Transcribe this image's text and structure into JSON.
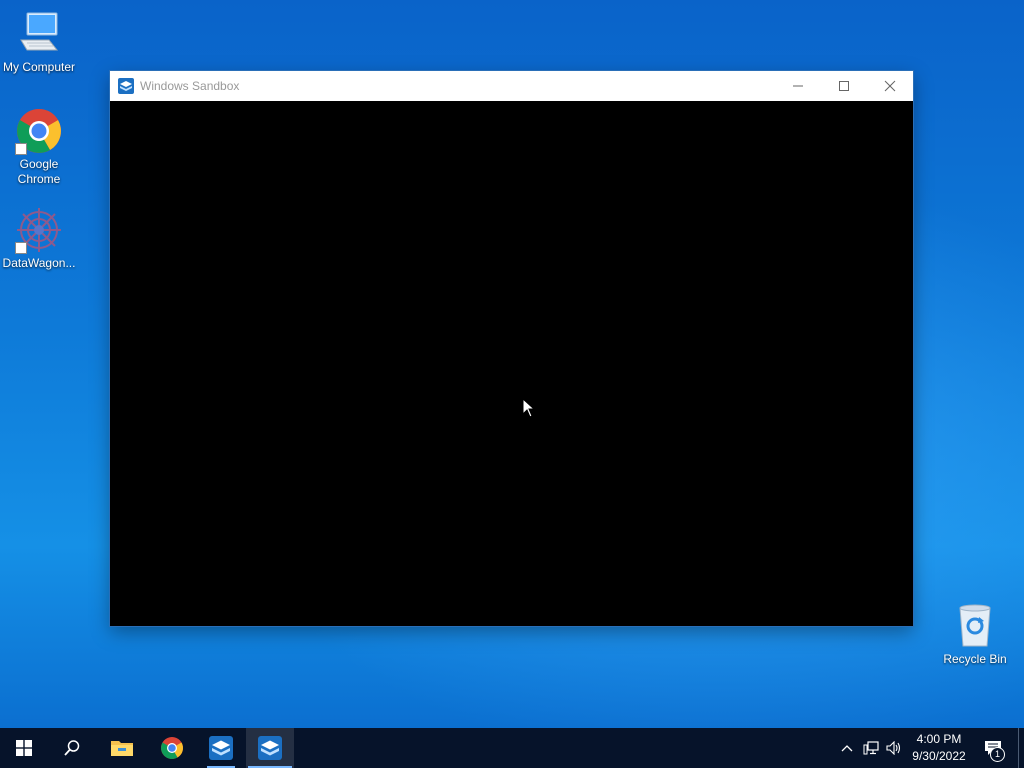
{
  "desktop": {
    "icons": [
      {
        "label": "My Computer",
        "icon": "computer-icon"
      },
      {
        "label": "Google Chrome",
        "icon": "chrome-icon",
        "shortcut": true
      },
      {
        "label": "DataWagon...",
        "icon": "datawagon-icon",
        "shortcut": true
      },
      {
        "label": "Recycle Bin",
        "icon": "recycle-bin-icon"
      }
    ]
  },
  "window": {
    "title": "Windows Sandbox",
    "icon": "sandbox-icon",
    "controls": [
      "minimize-icon",
      "maximize-icon",
      "close-icon"
    ]
  },
  "taskbar": {
    "pinned": [
      {
        "name": "start",
        "icon": "windows-logo-icon"
      },
      {
        "name": "search",
        "icon": "search-icon"
      },
      {
        "name": "file-explorer",
        "icon": "folder-icon"
      },
      {
        "name": "chrome",
        "icon": "chrome-icon"
      },
      {
        "name": "sandbox-1",
        "icon": "sandbox-icon"
      },
      {
        "name": "sandbox-2",
        "icon": "sandbox-icon",
        "active": true
      }
    ],
    "tray": {
      "icons": [
        "chevron-up-icon",
        "network-icon",
        "volume-icon"
      ],
      "time": "4:00 PM",
      "date": "9/30/2022",
      "notification_count": "1"
    }
  },
  "colors": {
    "desktop_blue": "#0e7ad8",
    "taskbar": "#06132a",
    "accent": "#0078d7"
  }
}
